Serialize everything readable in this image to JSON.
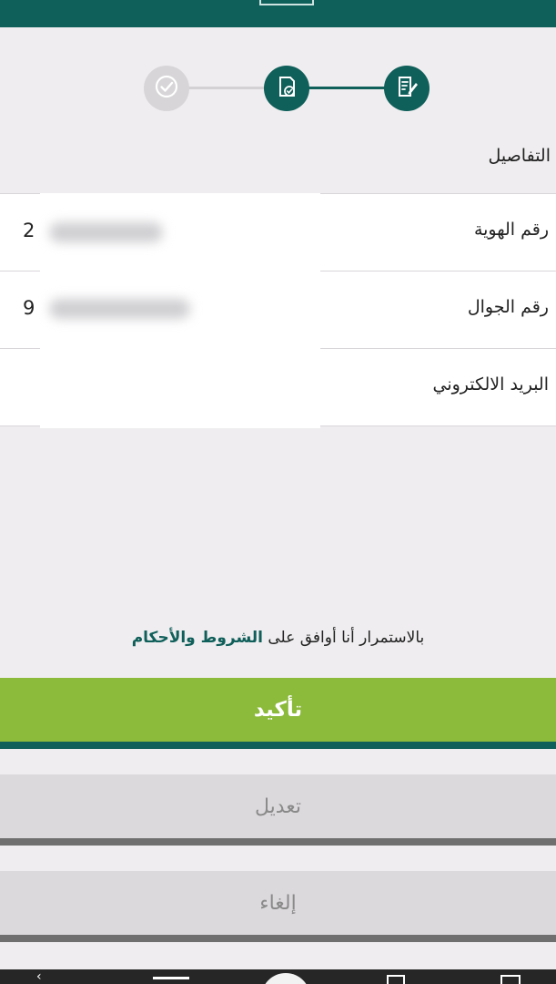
{
  "colors": {
    "primary": "#0f5f5a",
    "confirm": "#8cba3b",
    "secondary_button": "#dcd9dc",
    "background": "#efedef"
  },
  "stepper": {
    "steps": [
      {
        "icon": "check-circle-icon",
        "state": "completed"
      },
      {
        "icon": "document-check-icon",
        "state": "current"
      },
      {
        "icon": "edit-form-icon",
        "state": "active"
      }
    ]
  },
  "details": {
    "title": "التفاصيل",
    "rows": [
      {
        "label": "رقم الهوية",
        "value": "2"
      },
      {
        "label": "رقم الجوال",
        "value": "9"
      },
      {
        "label": "البريد الالكتروني",
        "value": ""
      }
    ]
  },
  "terms": {
    "prefix": "بالاستمرار أنا أوافق على ",
    "link": "الشروط والأحكام"
  },
  "buttons": {
    "confirm": "تأكيد",
    "edit": "تعديل",
    "cancel": "إلغاء"
  }
}
